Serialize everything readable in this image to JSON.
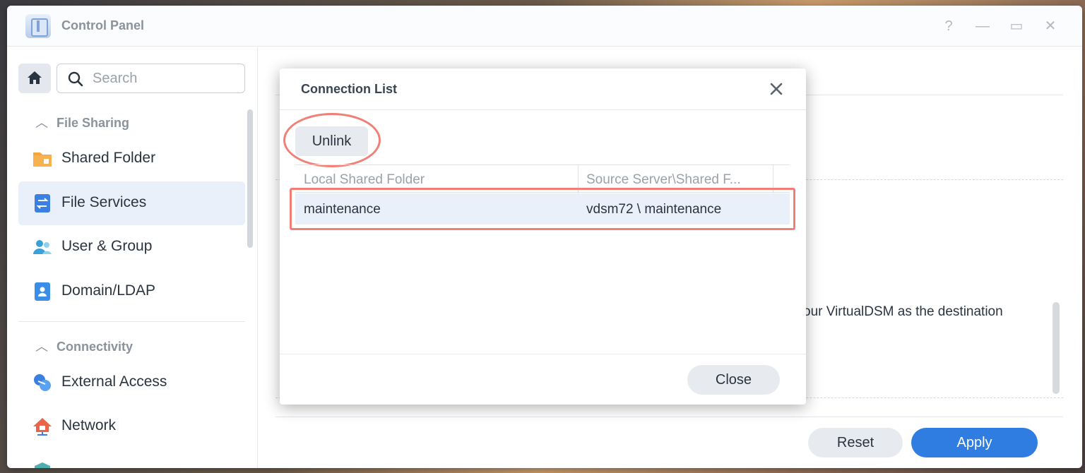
{
  "window": {
    "title": "Control Panel",
    "controls": [
      "?",
      "—",
      "▭",
      "✕"
    ]
  },
  "sidebar": {
    "search_placeholder": "Search",
    "sections": [
      {
        "label": "File Sharing",
        "items": [
          {
            "label": "Shared Folder",
            "icon": "folder-icon",
            "active": false
          },
          {
            "label": "File Services",
            "icon": "file-services-icon",
            "active": true
          },
          {
            "label": "User & Group",
            "icon": "user-group-icon",
            "active": false
          },
          {
            "label": "Domain/LDAP",
            "icon": "domain-ldap-icon",
            "active": false
          }
        ]
      },
      {
        "label": "Connectivity",
        "items": [
          {
            "label": "External Access",
            "icon": "external-access-icon",
            "active": false
          },
          {
            "label": "Network",
            "icon": "network-icon",
            "active": false
          }
        ]
      }
    ]
  },
  "main": {
    "partial_text": "our VirtualDSM as the destination",
    "reset_label": "Reset",
    "apply_label": "Apply"
  },
  "dialog": {
    "title": "Connection List",
    "unlink_label": "Unlink",
    "columns": [
      "Local Shared Folder",
      "Source Server\\Shared F..."
    ],
    "rows": [
      {
        "local": "maintenance",
        "source": "vdsm72 \\ maintenance"
      }
    ],
    "close_label": "Close"
  },
  "colors": {
    "accent": "#2f7de1",
    "highlight_ring": "#f08077",
    "selected_row": "#e9f0fa"
  }
}
